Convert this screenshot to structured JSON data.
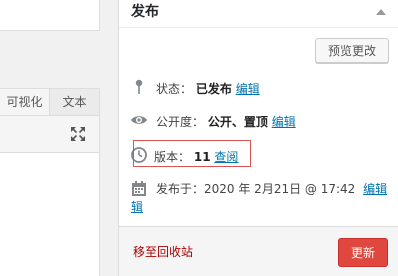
{
  "editor": {
    "tabs": [
      {
        "label": "可视化",
        "active": true
      },
      {
        "label": "文本",
        "active": false
      }
    ],
    "fullscreen_icon": "expand-arrows-icon"
  },
  "publish": {
    "title": "发布",
    "preview_button": "预览更改",
    "status": {
      "label": "状态：",
      "value": "已发布",
      "edit": "编辑",
      "icon": "pin-icon"
    },
    "visibility": {
      "label": "公开度：",
      "value": "公开、置顶",
      "edit": "编辑",
      "icon": "eye-icon"
    },
    "revisions": {
      "label": "版本：",
      "value": "11",
      "browse": "查阅",
      "icon": "clock-icon"
    },
    "date": {
      "label": "发布于：",
      "value": "2020 年 2月21日 @ 17:42",
      "edit_part1": "编辑",
      "edit_part2": "辑",
      "icon": "calendar-icon"
    },
    "trash_link": "移至回收站",
    "update_button": "更新"
  },
  "colors": {
    "link": "#0073aa",
    "trash": "#aa0000",
    "update_button": "#e0473f",
    "highlight_border": "#d9534f"
  }
}
